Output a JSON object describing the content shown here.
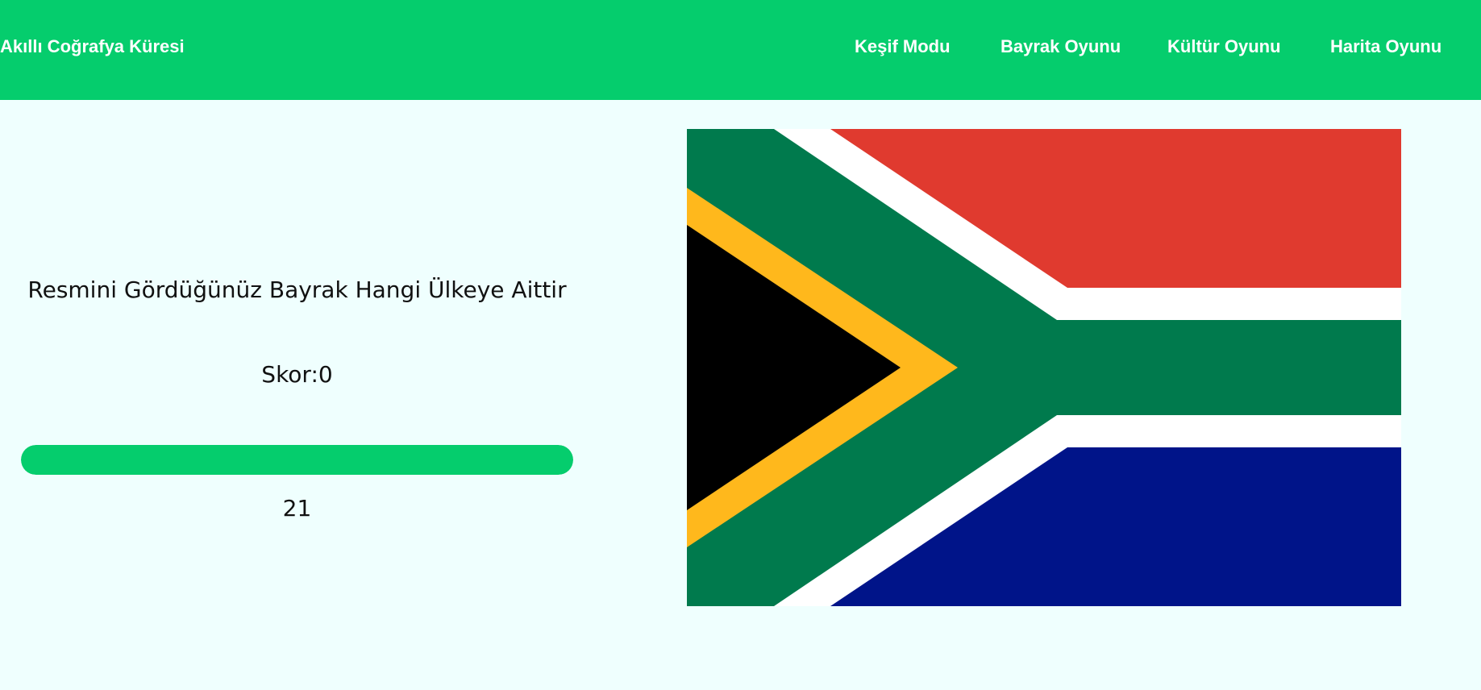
{
  "navbar": {
    "brand": "Akıllı Coğrafya Küresi",
    "links": [
      {
        "label": "Keşif Modu"
      },
      {
        "label": "Bayrak Oyunu"
      },
      {
        "label": "Kültür Oyunu"
      },
      {
        "label": "Harita Oyunu"
      }
    ]
  },
  "game": {
    "question": "Resmini Gördüğünüz Bayrak Hangi Ülkeye Aittir",
    "score_text": "Skor:0",
    "timer_value": "21",
    "progress_fraction": 1.0
  },
  "flag": {
    "colors": {
      "red": "#e03a2f",
      "white": "#ffffff",
      "green": "#007a4d",
      "gold": "#ffb81c",
      "black": "#000000",
      "blue": "#001489"
    }
  },
  "theme": {
    "accent": "#05cd6d",
    "background": "#effffe"
  }
}
